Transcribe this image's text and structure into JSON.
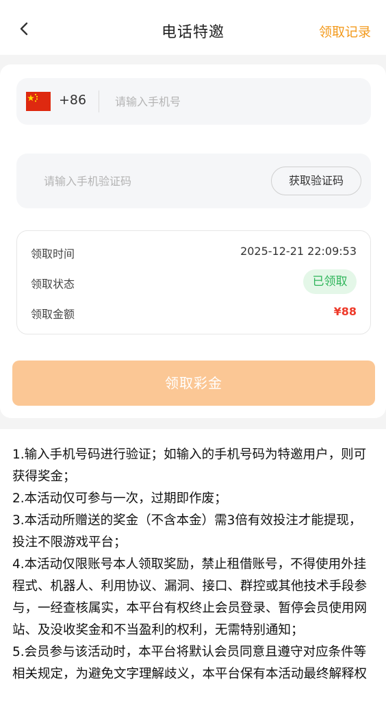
{
  "header": {
    "title": "电话特邀",
    "records_label": "领取记录"
  },
  "phone": {
    "flag_icon": "china-flag",
    "country_code": "+86",
    "placeholder": "请输入手机号"
  },
  "verification": {
    "placeholder": "请输入手机验证码",
    "get_code_label": "获取验证码"
  },
  "claim_info": {
    "time_label": "领取时间",
    "time_value": "2025-12-21 22:09:53",
    "status_label": "领取状态",
    "status_value": "已领取",
    "amount_label": "领取金额",
    "amount_value": "¥88"
  },
  "claim_button_label": "领取彩金",
  "rules": [
    "1.输入手机号码进行验证；如输入的手机号码为特邀用户，则可获得奖金；",
    "2.本活动仅可参与一次，过期即作废；",
    "3.本活动所赠送的奖金（不含本金）需3倍有效投注才能提现，投注不限游戏平台；",
    "4.本活动仅限账号本人领取奖励，禁止租借账号，不得使用外挂程式、机器人、利用协议、漏洞、接口、群控或其他技术手段参与，一经查核属实，本平台有权终止会员登录、暂停会员使用网站、及没收奖金和不当盈利的权利，无需特别通知；",
    "5.会员参与该活动时，本平台将默认会员同意且遵守对应条件等相关规定，为避免文字理解歧义，本平台保有本活动最终解释权"
  ],
  "colors": {
    "accent": "#f39a1c",
    "button": "#fbc795",
    "status_green": "#2fb55a",
    "amount_red": "#ee3a2a"
  }
}
